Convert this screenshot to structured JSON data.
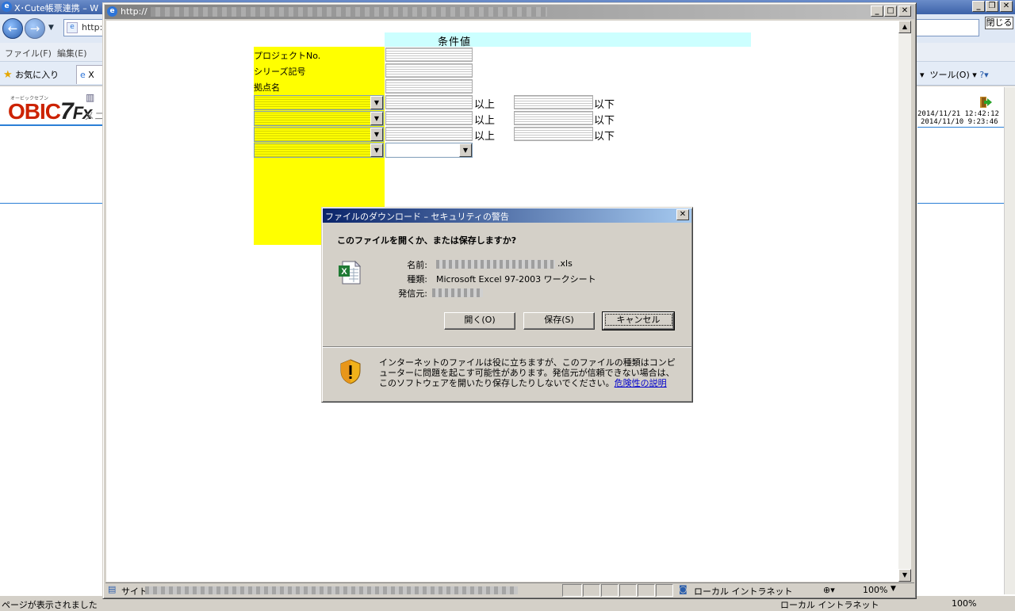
{
  "outer_window": {
    "title": "X･Cute帳票連携 – W",
    "address_prefix": "http:/",
    "close_label": "閉じる",
    "menu": [
      "ファイル(F)",
      "編集(E)"
    ],
    "favorites": "お気に入り",
    "tab_label": "X",
    "tools": "ツール(O) ▾",
    "menu_fragment": "メニ",
    "timestamps": [
      "2014/11/21 12:42:12",
      "2014/11/10 9:23:46"
    ],
    "status_text": "ページが表示されました",
    "zone": "ローカル イントラネット",
    "zoom": "100%"
  },
  "popup": {
    "url_prefix": "http://",
    "status_site": "サイト",
    "zone": "ローカル イントラネット",
    "zoom": "100%"
  },
  "form": {
    "header": "条件値",
    "labels": [
      "プロジェクトNo.",
      "シリーズ記号",
      "拠点名"
    ],
    "range_from": "以上",
    "range_to": "以下"
  },
  "dialog": {
    "title": "ファイルのダウンロード – セキュリティの警告",
    "question": "このファイルを開くか、または保存しますか?",
    "name_label": "名前:",
    "name_suffix": ".xls",
    "type_label": "種類:",
    "type_value": "Microsoft Excel 97-2003 ワークシート",
    "source_label": "発信元:",
    "open_button": "開く(O)",
    "save_button": "保存(S)",
    "cancel_button": "キャンセル",
    "warning": "インターネットのファイルは役に立ちますが、このファイルの種類はコンピューターに問題を起こす可能性があります。発信元が信頼できない場合は、このソフトウェアを開いたり保存したりしないでください。",
    "risk_link": "危険性の説明"
  }
}
